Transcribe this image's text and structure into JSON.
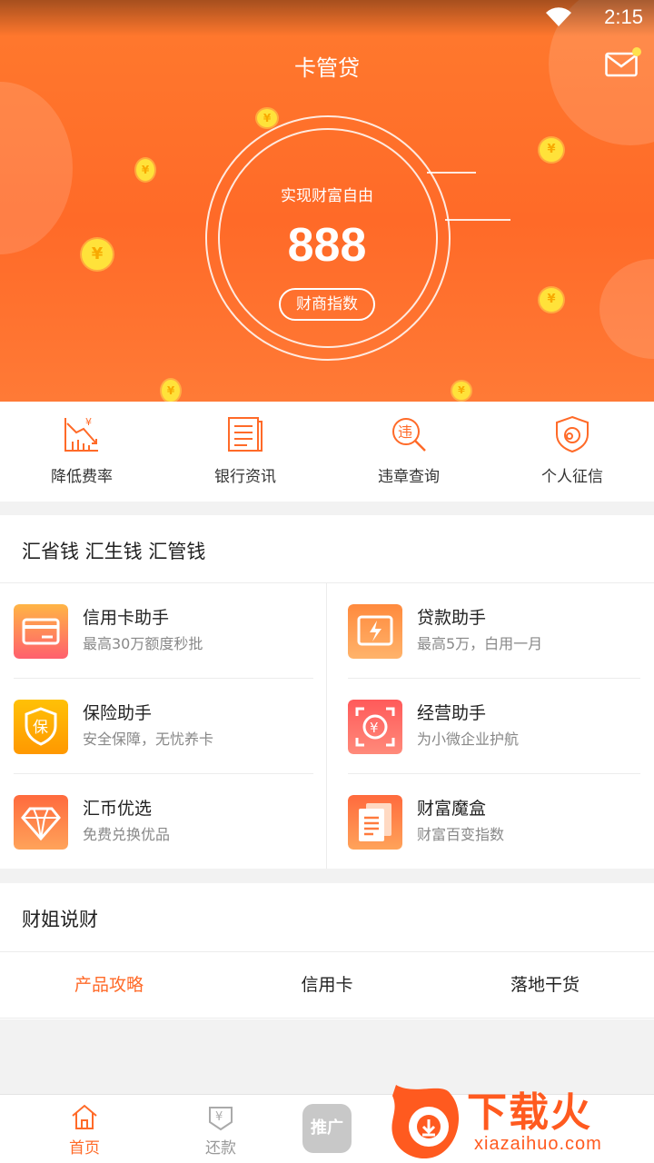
{
  "status_bar": {
    "time": "2:15",
    "icons": [
      "wifi-icon"
    ]
  },
  "header": {
    "title": "卡管贷",
    "mail_icon": "mail-icon"
  },
  "hero": {
    "caption": "实现财富自由",
    "score": "888",
    "button_label": "财商指数",
    "coin_glyph": "¥"
  },
  "quick_nav": [
    {
      "label": "降低费率",
      "icon": "rate-down-icon"
    },
    {
      "label": "银行资讯",
      "icon": "bank-news-icon"
    },
    {
      "label": "违章查询",
      "icon": "violation-search-icon"
    },
    {
      "label": "个人征信",
      "icon": "credit-shield-icon"
    }
  ],
  "services": {
    "title": "汇省钱 汇生钱 汇管钱",
    "items": [
      {
        "name": "信用卡助手",
        "desc": "最高30万额度秒批",
        "icon": "credit-card-icon",
        "color": "#ff6b6b"
      },
      {
        "name": "贷款助手",
        "desc": "最高5万，白用一月",
        "icon": "lightning-card-icon",
        "color": "#ff8a3d"
      },
      {
        "name": "保险助手",
        "desc": "安全保障，无忧养卡",
        "icon": "insurance-shield-icon",
        "color": "#ffb300",
        "badge": "保"
      },
      {
        "name": "经营助手",
        "desc": "为小微企业护航",
        "icon": "business-yuan-icon",
        "color": "#ff5a5a",
        "badge": "¥"
      },
      {
        "name": "汇币优选",
        "desc": "免费兑换优品",
        "icon": "diamond-icon",
        "color": "#ff7a3d"
      },
      {
        "name": "财富魔盒",
        "desc": "财富百变指数",
        "icon": "document-stack-icon",
        "color": "#ff7a3d"
      }
    ]
  },
  "talk": {
    "title": "财姐说财",
    "tabs": [
      {
        "label": "产品攻略",
        "active": true
      },
      {
        "label": "信用卡",
        "active": false
      },
      {
        "label": "落地干货",
        "active": false
      }
    ]
  },
  "tabbar": {
    "items": [
      {
        "label": "首页",
        "icon": "home-icon",
        "active": true
      },
      {
        "label": "还款",
        "icon": "repay-icon",
        "active": false
      }
    ],
    "promo_label": "推广"
  },
  "watermark": {
    "text": "下载火",
    "url": "xiazaihuo.com"
  },
  "colors": {
    "accent": "#ff6a28",
    "hero_top": "#ff7a2e",
    "coin": "#ffe23a"
  }
}
